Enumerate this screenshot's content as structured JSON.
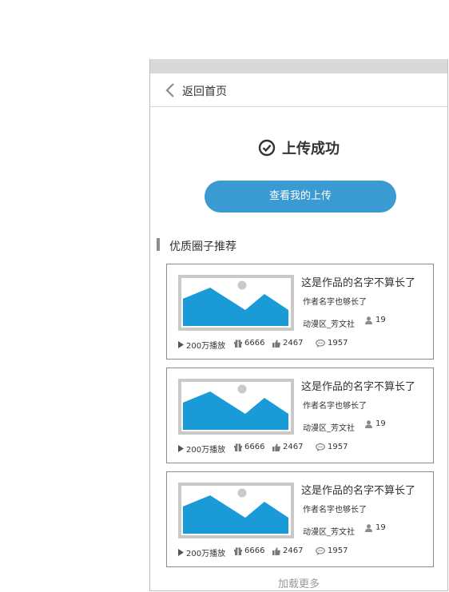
{
  "nav": {
    "back_label": "返回首页"
  },
  "status": {
    "title": "上传成功"
  },
  "actions": {
    "view_uploads_label": "查看我的上传"
  },
  "section": {
    "title": "优质圈子推荐"
  },
  "cards": [
    {
      "title": "这是作品的名字不算长了",
      "author": "作者名字也够长了",
      "zone": "动漫区_芳文社",
      "members": "19",
      "plays": "200万播放",
      "gifts": "6666",
      "likes": "2467",
      "comments": "1957"
    },
    {
      "title": "这是作品的名字不算长了",
      "author": "作者名字也够长了",
      "zone": "动漫区_芳文社",
      "members": "19",
      "plays": "200万播放",
      "gifts": "6666",
      "likes": "2467",
      "comments": "1957"
    },
    {
      "title": "这是作品的名字不算长了",
      "author": "作者名字也够长了",
      "zone": "动漫区_芳文社",
      "members": "19",
      "plays": "200万播放",
      "gifts": "6666",
      "likes": "2467",
      "comments": "1957"
    }
  ],
  "footer": {
    "load_more": "加载更多"
  },
  "colors": {
    "accent": "#3a9bd3",
    "thumb_blue": "#1a9ad6",
    "border": "#8c8c8c"
  },
  "icons": {
    "back": "chevron-left-icon",
    "success": "check-circle-icon",
    "play": "play-icon",
    "gift": "gift-icon",
    "like": "thumbs-up-icon",
    "comment": "comment-icon",
    "user": "user-icon"
  }
}
